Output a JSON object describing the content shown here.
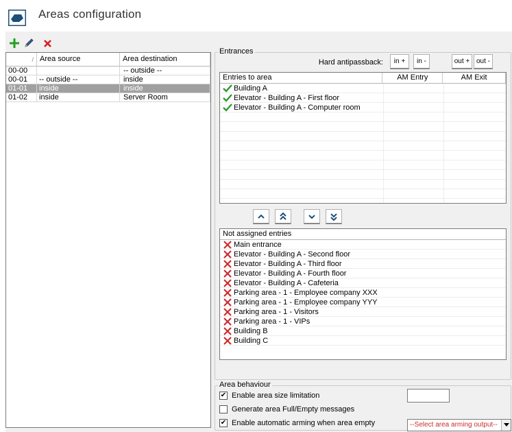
{
  "header": {
    "title": "Areas configuration",
    "icon": "area-map-icon"
  },
  "toolbar": {
    "add": "add-icon",
    "edit": "edit-pencil-icon",
    "delete": "delete-icon"
  },
  "areas_table": {
    "columns": [
      "/",
      "Area source",
      "Area destination"
    ],
    "rows": [
      {
        "id": "00-00",
        "source": "",
        "destination": "-- outside --"
      },
      {
        "id": "00-01",
        "source": "-- outside --",
        "destination": "inside"
      },
      {
        "id": "01-01",
        "source": "inside",
        "destination": "inside",
        "selected": true
      },
      {
        "id": "01-02",
        "source": "inside",
        "destination": "Server Room"
      }
    ]
  },
  "entrances": {
    "legend": "Entrances",
    "hard_antipassback_label": "Hard antipassback:",
    "buttons": {
      "in_plus": "in +",
      "in_minus": "in -",
      "out_plus": "out +",
      "out_minus": "out -"
    },
    "entries_columns": [
      "Entries to area",
      "AM Entry",
      "AM Exit"
    ],
    "entries": [
      "Building A",
      "Elevator - Building A - First floor",
      "Elevator - Building A - Computer room"
    ],
    "not_assigned_header": "Not assigned entries",
    "not_assigned": [
      "Main entrance",
      "Elevator - Building A - Second floor",
      "Elevator - Building A - Third floor",
      "Elevator - Building A - Fourth floor",
      "Elevator - Building A - Cafeteria",
      "Parking area - 1 - Employee company XXX",
      "Parking area - 1 - Employee company YYY",
      "Parking area - 1 - Visitors",
      "Parking area - 1 - VIPs",
      "Building B",
      "Building C"
    ]
  },
  "behaviour": {
    "legend": "Area behaviour",
    "size_limit_label": "Enable area size limitation",
    "size_limit_checked": true,
    "size_limit_value": "",
    "full_empty_label": "Generate area Full/Empty messages",
    "full_empty_checked": false,
    "auto_arming_label": "Enable automatic arming when area empty",
    "auto_arming_checked": true,
    "arming_output_selected": "--Select area arming output--"
  },
  "colors": {
    "selected_row": "#a0a0a0",
    "check_green": "#2e9a2e",
    "cross_red": "#cc2b2b",
    "panel_bg": "#f0f0f0"
  }
}
